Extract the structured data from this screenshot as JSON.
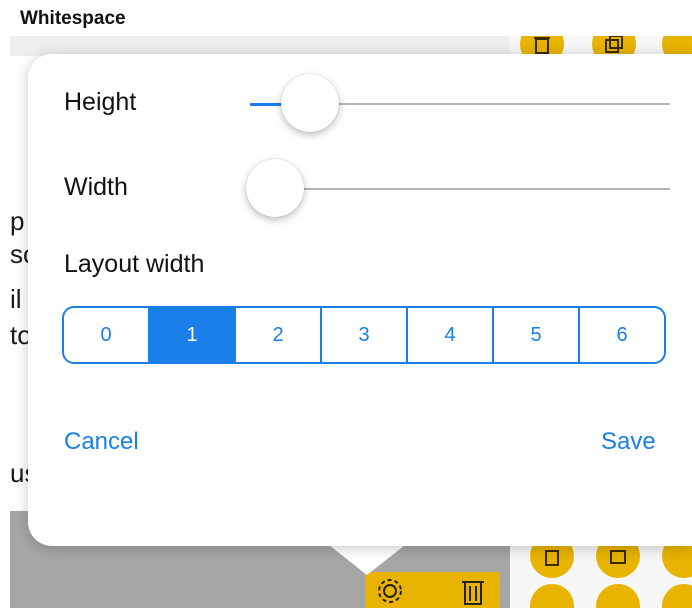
{
  "window_title": "Whitespace",
  "popover": {
    "height_label": "Height",
    "height_value": 0.12,
    "width_label": "Width",
    "width_value": 0.0,
    "layout_width_label": "Layout width",
    "layout_width_options": [
      "0",
      "1",
      "2",
      "3",
      "4",
      "5",
      "6"
    ],
    "layout_width_selected": "1",
    "cancel_label": "Cancel",
    "save_label": "Save"
  },
  "background": {
    "text_fragments": [
      "p",
      "sc",
      "il",
      "to",
      "us"
    ]
  },
  "colors": {
    "accent": "#1a7fe8",
    "toolbar_yellow": "#e8b400",
    "overlay_gray": "#a6a6a6"
  },
  "icons": [
    "trash-icon",
    "copy-icon",
    "gear-icon"
  ]
}
